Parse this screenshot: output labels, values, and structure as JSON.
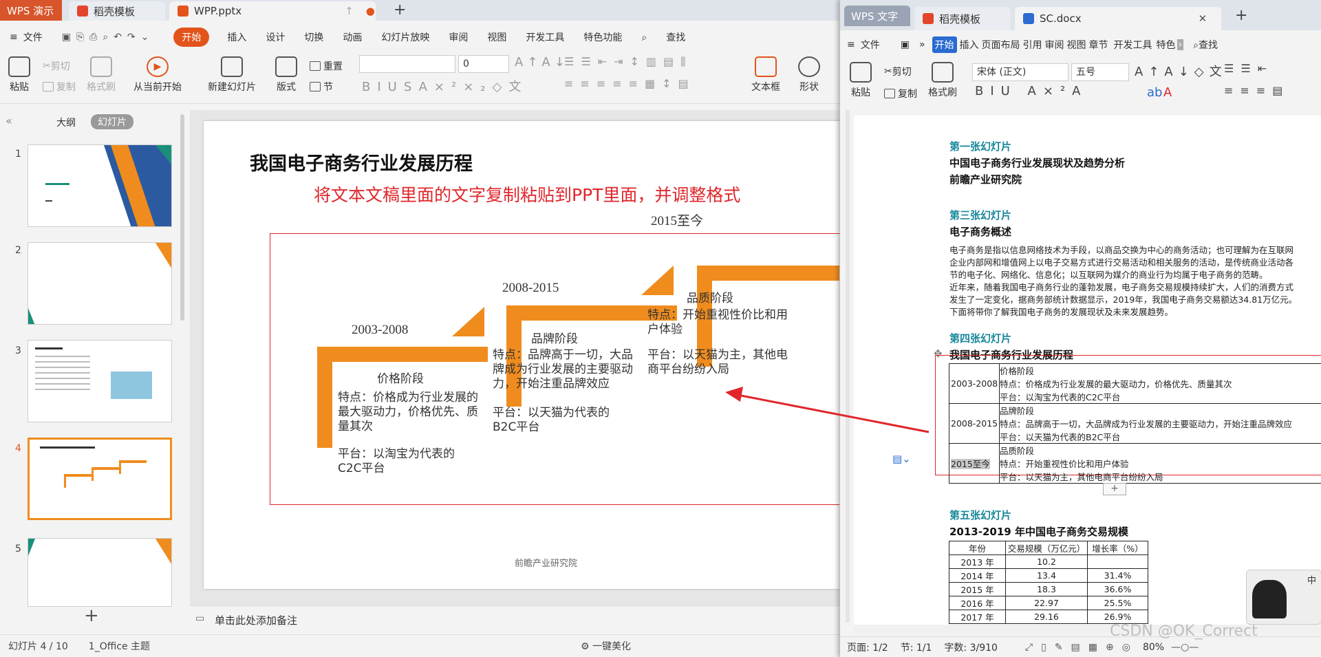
{
  "wpp": {
    "app_tab": "WPS 演示",
    "tabs": [
      "稻壳模板",
      "WPP.pptx"
    ],
    "menu": [
      "文件",
      "开始",
      "插入",
      "设计",
      "切换",
      "动画",
      "幻灯片放映",
      "审阅",
      "视图",
      "开发工具",
      "特色功能",
      "查找"
    ],
    "ribbon": {
      "paste": "粘贴",
      "cut": "剪切",
      "copy": "复制",
      "format_painter": "格式刷",
      "from_start": "从当前开始",
      "new_slide": "新建幻灯片",
      "layout": "版式",
      "reset": "重置",
      "section": "节",
      "font_size": "0",
      "textbox": "文本框",
      "shape": "形状"
    },
    "panel_tabs": [
      "大纲",
      "幻灯片"
    ],
    "slide_numbers": [
      "1",
      "2",
      "3",
      "4",
      "5"
    ],
    "add_note": "单击此处添加备注",
    "status": {
      "slide": "幻灯片 4 / 10",
      "theme": "1_Office 主题",
      "beautify": "一键美化"
    }
  },
  "slide": {
    "title": "我国电子商务行业发展历程",
    "instruction": "将文本文稿里面的文字复制粘贴到PPT里面，并调整格式",
    "footer": "前瞻产业研究院",
    "stages": [
      {
        "year": "2003-2008",
        "name": "价格阶段",
        "feature": "特点：价格成为行业发展的最大驱动力，价格优先、质量其次",
        "platform": "平台：以淘宝为代表的C2C平台"
      },
      {
        "year": "2008-2015",
        "name": "品牌阶段",
        "feature": "特点：品牌高于一切，大品牌成为行业发展的主要驱动力，开始注重品牌效应",
        "platform": "平台：以天猫为代表的B2C平台"
      },
      {
        "year": "2015至今",
        "name": "品质阶段",
        "feature": "特点：开始重视性价比和用户体验",
        "platform": "平台：以天猫为主，其他电商平台纷纷入局"
      }
    ]
  },
  "wps": {
    "app_tab": "WPS 文字",
    "tabs": [
      "稻壳模板",
      "SC.docx"
    ],
    "menu": [
      "文件",
      "开始",
      "插入",
      "页面布局",
      "引用",
      "审阅",
      "视图",
      "章节",
      "开发工具",
      "特色",
      "查找"
    ],
    "ribbon": {
      "paste": "粘贴",
      "cut": "剪切",
      "copy": "复制",
      "format_painter": "格式刷",
      "font": "宋体 (正文)",
      "size": "五号"
    },
    "status": {
      "page": "页面: 1/2",
      "section": "节: 1/1",
      "words": "字数: 3/910",
      "zoom": "80%"
    },
    "watermark": "CSDN @OK_Correct"
  },
  "doc": {
    "s1_head": "第一张幻灯片",
    "s1_title": "中国电子商务行业发展现状及趋势分析",
    "s1_org": "前瞻产业研究院",
    "s3_head": "第三张幻灯片",
    "s3_title": "电子商务概述",
    "s3_lines": [
      "电子商务是指以信息网络技术为手段，以商品交换为中心的商务活动；也可理解为在互联网",
      "企业内部网和增值网上以电子交易方式进行交易活动和相关服务的活动，是传统商业活动各",
      "节的电子化、网络化、信息化；以互联网为媒介的商业行为均属于电子商务的范畴。",
      "近年来，随着我国电子商务行业的蓬勃发展，电子商务交易规模持续扩大，人们的消费方式",
      "发生了一定变化，据商务部统计数据显示，2019年，我国电子商务交易额达34.81万亿元。",
      "下面将带你了解我国电子商务的发展现状及未来发展趋势。"
    ],
    "s4_head": "第四张幻灯片",
    "s4_title": "我国电子商务行业发展历程",
    "s5_head": "第五张幻灯片",
    "s5_title": "2013-2019 年中国电子商务交易规模",
    "s5_table": {
      "headers": [
        "年份",
        "交易规模（万亿元）",
        "增长率（%）"
      ],
      "rows": [
        [
          "2013 年",
          "10.2",
          ""
        ],
        [
          "2014 年",
          "13.4",
          "31.4%"
        ],
        [
          "2015 年",
          "18.3",
          "36.6%"
        ],
        [
          "2016 年",
          "22.97",
          "25.5%"
        ],
        [
          "2017 年",
          "29.16",
          "26.9%"
        ]
      ]
    }
  },
  "colors": {
    "accent": "#e2541b",
    "orange": "#f08c1e",
    "teal": "#17889b",
    "red": "#e0262b"
  }
}
